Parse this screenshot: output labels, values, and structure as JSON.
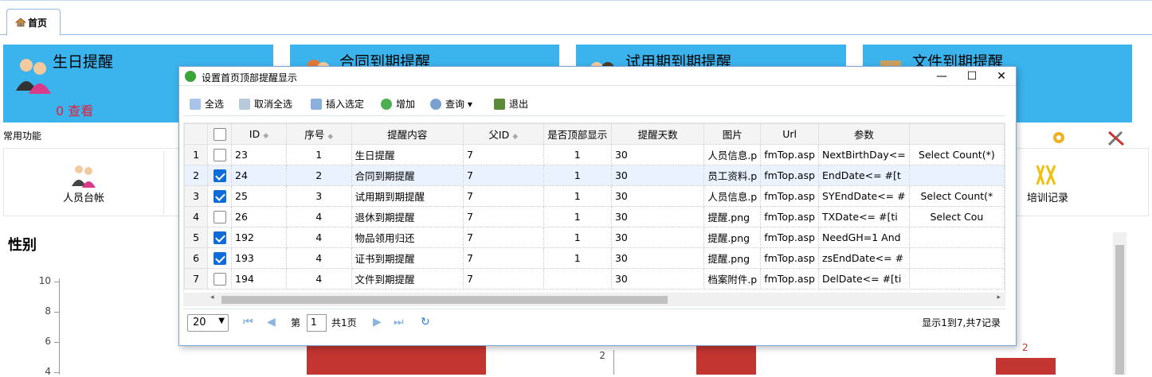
{
  "tabs": [
    {
      "label": "首页"
    }
  ],
  "cards": [
    {
      "title": "生日提醒",
      "count": "0 查看"
    },
    {
      "title": "合同到期提醒"
    },
    {
      "title": "试用期到期提醒"
    },
    {
      "title": "文件到期提醒"
    }
  ],
  "section_label": "常用功能",
  "quick": [
    {
      "label": "人员台帐"
    },
    {
      "label": "培训记录"
    }
  ],
  "chart": {
    "title": "性别",
    "y_ticks": [
      "10",
      "8",
      "6",
      "4"
    ],
    "right_tick": "2",
    "right_label": "2"
  },
  "chart_data": [
    {
      "type": "bar",
      "title": "性别",
      "yaxis": [
        10,
        8,
        6,
        4
      ]
    }
  ],
  "colors": {
    "card": "#3bb3ec",
    "accent": "#0f6bd6",
    "bar": "#c23531",
    "count": "#e2203b"
  },
  "dialog": {
    "title": "设置首页顶部提醒显示",
    "toolbar": [
      "全选",
      "取消全选",
      "插入选定",
      "增加",
      "查询",
      "退出"
    ],
    "columns": [
      "ID",
      "序号",
      "提醒内容",
      "父ID",
      "是否顶部显示",
      "提醒天数",
      "图片",
      "Url",
      "参数"
    ],
    "rows": [
      {
        "rn": "1",
        "checked": false,
        "id": "23",
        "seq": "1",
        "content": "生日提醒",
        "pid": "7",
        "top": "1",
        "days": "30",
        "img": "人员信息.p",
        "url": "fmTop.asp",
        "param": "NextBirthDay<=",
        "extra": "Select Count(*)"
      },
      {
        "rn": "2",
        "checked": true,
        "id": "24",
        "seq": "2",
        "content": "合同到期提醒",
        "pid": "7",
        "top": "1",
        "days": "30",
        "img": "员工资料.p",
        "url": "fmTop.asp",
        "param": "EndDate<= #[t",
        "extra": ""
      },
      {
        "rn": "3",
        "checked": true,
        "id": "25",
        "seq": "3",
        "content": "试用期到期提醒",
        "pid": "7",
        "top": "1",
        "days": "30",
        "img": "人员信息.p",
        "url": "fmTop.asp",
        "param": "SYEndDate<= #",
        "extra": "Select Count(*"
      },
      {
        "rn": "4",
        "checked": false,
        "id": "26",
        "seq": "4",
        "content": "退休到期提醒",
        "pid": "7",
        "top": "1",
        "days": "30",
        "img": "提醒.png",
        "url": "fmTop.asp",
        "param": "TXDate<= #[ti",
        "extra": "Select Cou"
      },
      {
        "rn": "5",
        "checked": true,
        "id": "192",
        "seq": "4",
        "content": "物品领用归还",
        "pid": "7",
        "top": "1",
        "days": "30",
        "img": "提醒.png",
        "url": "fmTop.asp",
        "param": "NeedGH=1 And",
        "extra": ""
      },
      {
        "rn": "6",
        "checked": true,
        "id": "193",
        "seq": "4",
        "content": "证书到期提醒",
        "pid": "7",
        "top": "1",
        "days": "30",
        "img": "提醒.png",
        "url": "fmTop.asp",
        "param": "zsEndDate<= #",
        "extra": ""
      },
      {
        "rn": "7",
        "checked": false,
        "id": "194",
        "seq": "4",
        "content": "文件到期提醒",
        "pid": "7",
        "top": "",
        "days": "30",
        "img": "档案附件.p",
        "url": "fmTop.asp",
        "param": "DelDate<= #[ti",
        "extra": ""
      }
    ],
    "pager": {
      "size": "20",
      "page_prefix": "第",
      "page": "1",
      "page_total": "共1页",
      "summary": "显示1到7,共7记录"
    }
  }
}
